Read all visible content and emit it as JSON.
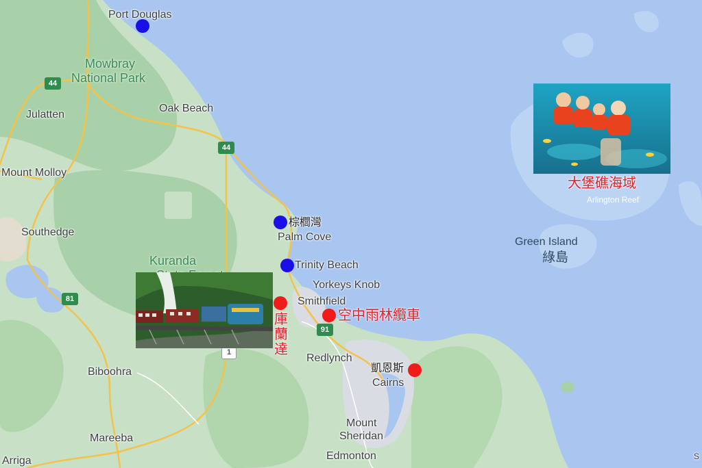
{
  "colors": {
    "water": "#a8c6f0",
    "land": "#c8e1c6",
    "forest": "#a9d1a9",
    "road": "#f2c24a",
    "blue_marker": "#1a0fe6",
    "red_marker": "#f01c1c"
  },
  "places": {
    "port_douglas": "Port Douglas",
    "oak_beach": "Oak Beach",
    "julatten": "Julatten",
    "mount_molloy": "Mount Molloy",
    "southedge": "Southedge",
    "palm_cove": "Palm Cove",
    "trinity_beach": "Trinity Beach",
    "yorkeys_knob": "Yorkeys Knob",
    "smithfield": "Smithfield",
    "redlynch": "Redlynch",
    "cairns": "Cairns",
    "biboohra": "Biboohra",
    "mareeba": "Mareeba",
    "arriga": "Arriga",
    "mount_sheridan_1": "Mount",
    "mount_sheridan_2": "Sheridan",
    "edmonton": "Edmonton"
  },
  "parks": {
    "mowbray_1": "Mowbray",
    "mowbray_2": "National Park",
    "kuranda_1": "Kuranda",
    "kuranda_2": "State Forest"
  },
  "water_features": {
    "green_island": "Green Island",
    "green_island_zh": "綠島",
    "arlington_reef": "Arlington Reef"
  },
  "highways": {
    "h44_a": "44",
    "h44_b": "44",
    "h81": "81",
    "h91": "91",
    "h1": "1"
  },
  "markers": {
    "blue": [
      {
        "name": "port-douglas",
        "label": ""
      },
      {
        "name": "palm-cove",
        "label": "棕櫚灣"
      },
      {
        "name": "trinity-beach",
        "label": ""
      }
    ],
    "red": [
      {
        "name": "kuranda",
        "label_chars": [
          "庫",
          "蘭",
          "達"
        ]
      },
      {
        "name": "skyrail",
        "label": "空中雨林纜車"
      },
      {
        "name": "cairns",
        "label": "凱恩斯"
      }
    ]
  },
  "photos": {
    "reef_caption": "大堡礁海域"
  },
  "corner": "S"
}
